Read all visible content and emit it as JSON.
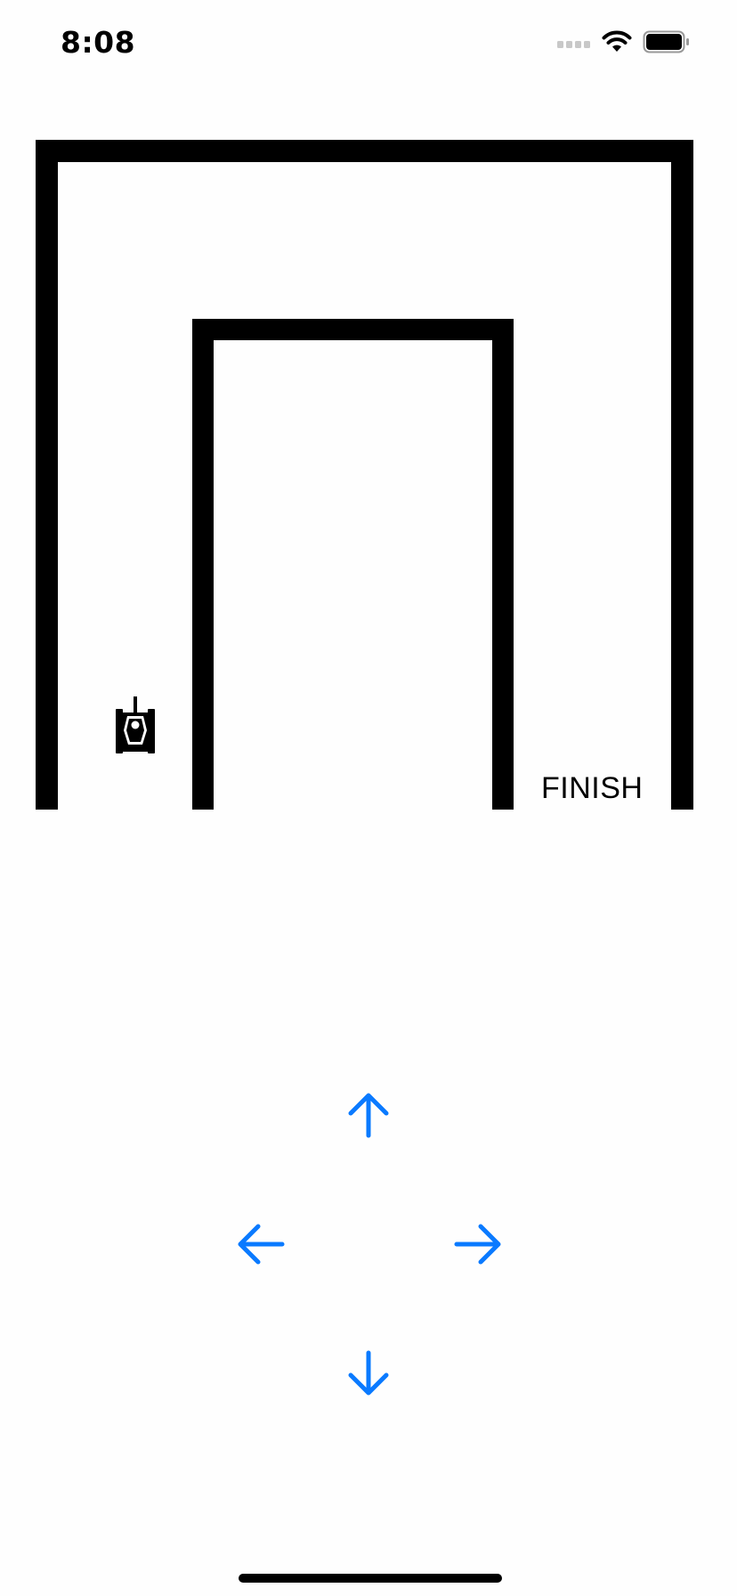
{
  "status_bar": {
    "time": "8:08",
    "signal_icon": "cellular-signal-icon",
    "wifi_icon": "wifi-icon",
    "battery_icon": "battery-icon"
  },
  "maze": {
    "finish_label": "FINISH",
    "player_icon": "tank-icon",
    "wall_color": "#000000"
  },
  "controls": {
    "up_icon": "arrow-up-icon",
    "left_icon": "arrow-left-icon",
    "right_icon": "arrow-right-icon",
    "down_icon": "arrow-down-icon",
    "accent_color": "#0A7AFF"
  }
}
